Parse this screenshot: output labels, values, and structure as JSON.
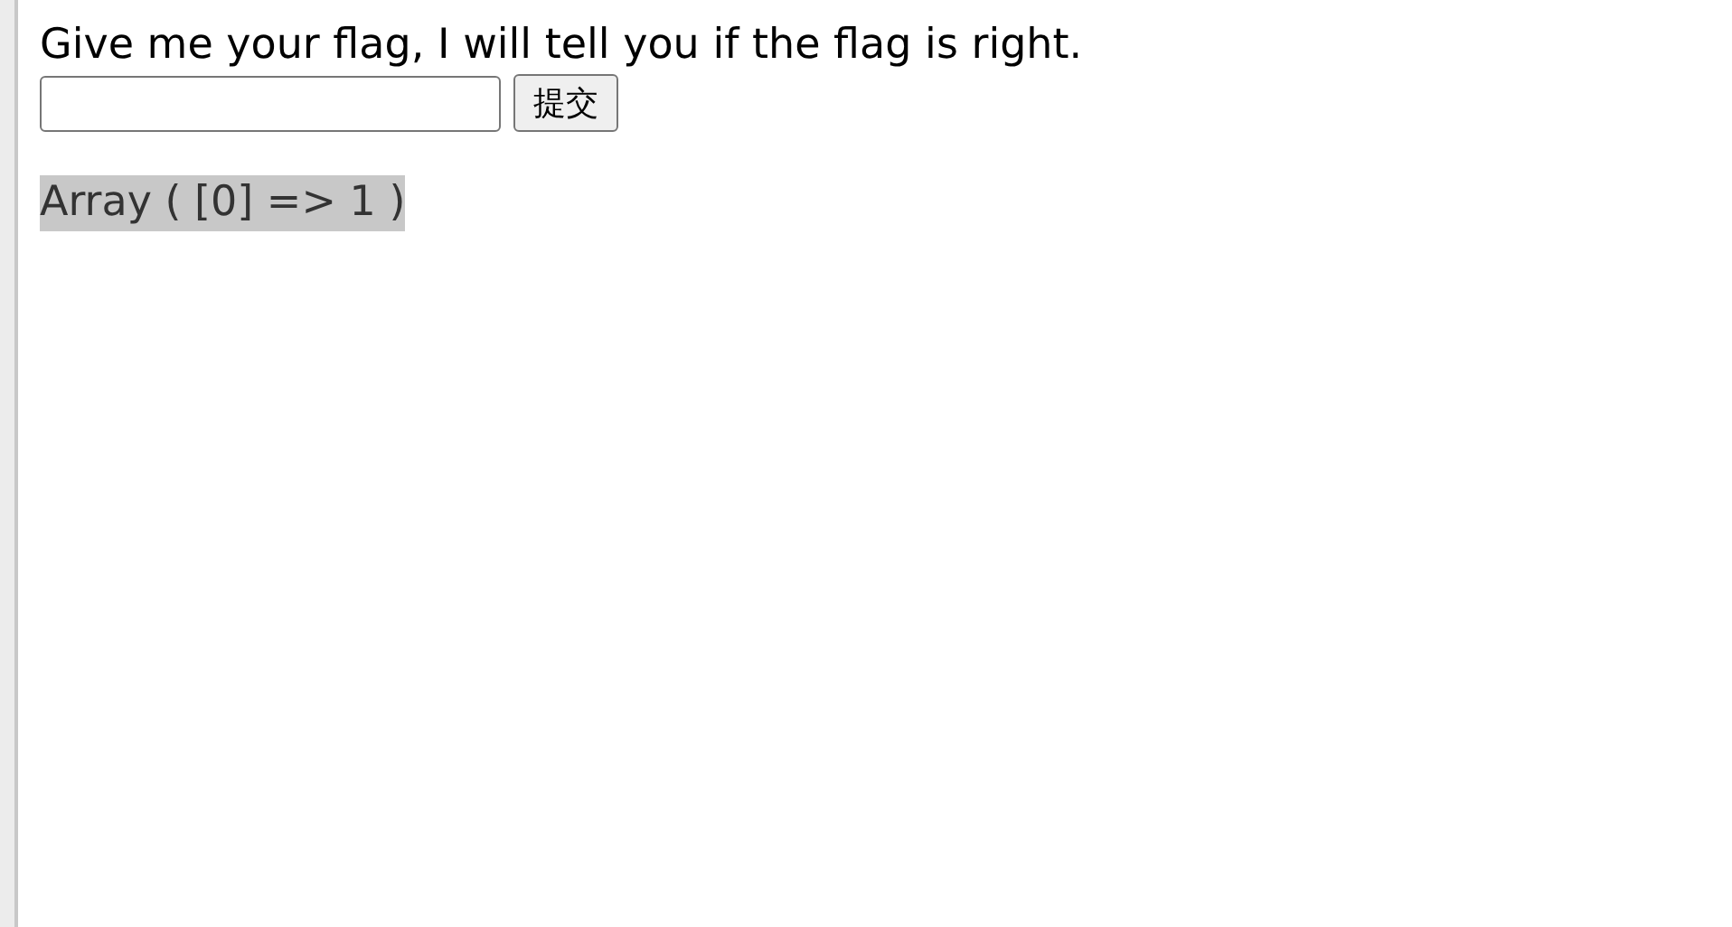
{
  "prompt": "Give me your flag, I will tell you if the flag is right.",
  "submit_button": {
    "label": "提交"
  },
  "result": "Array ( [0] => 1 )"
}
